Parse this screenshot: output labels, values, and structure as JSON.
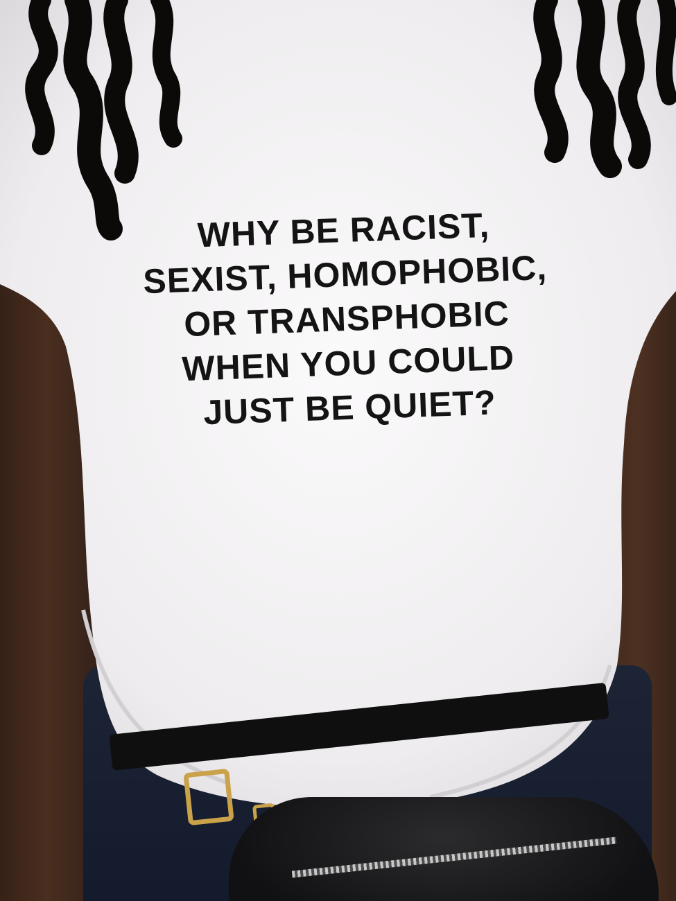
{
  "photo": {
    "shirt_text": {
      "line1": "WHY BE RACIST,",
      "line2": "SEXIST, HOMOPHOBIC,",
      "line3": "OR TRANSPHOBIC",
      "line4": "WHEN YOU COULD",
      "line5": "JUST BE QUIET?"
    },
    "colors": {
      "shirt": "#f3f1f2",
      "skin": "#3b2519",
      "hair": "#0c0a09",
      "jeans": "#161e30",
      "belt": "#0f0f10",
      "buckle": "#c9a24a",
      "text": "#141414"
    }
  }
}
